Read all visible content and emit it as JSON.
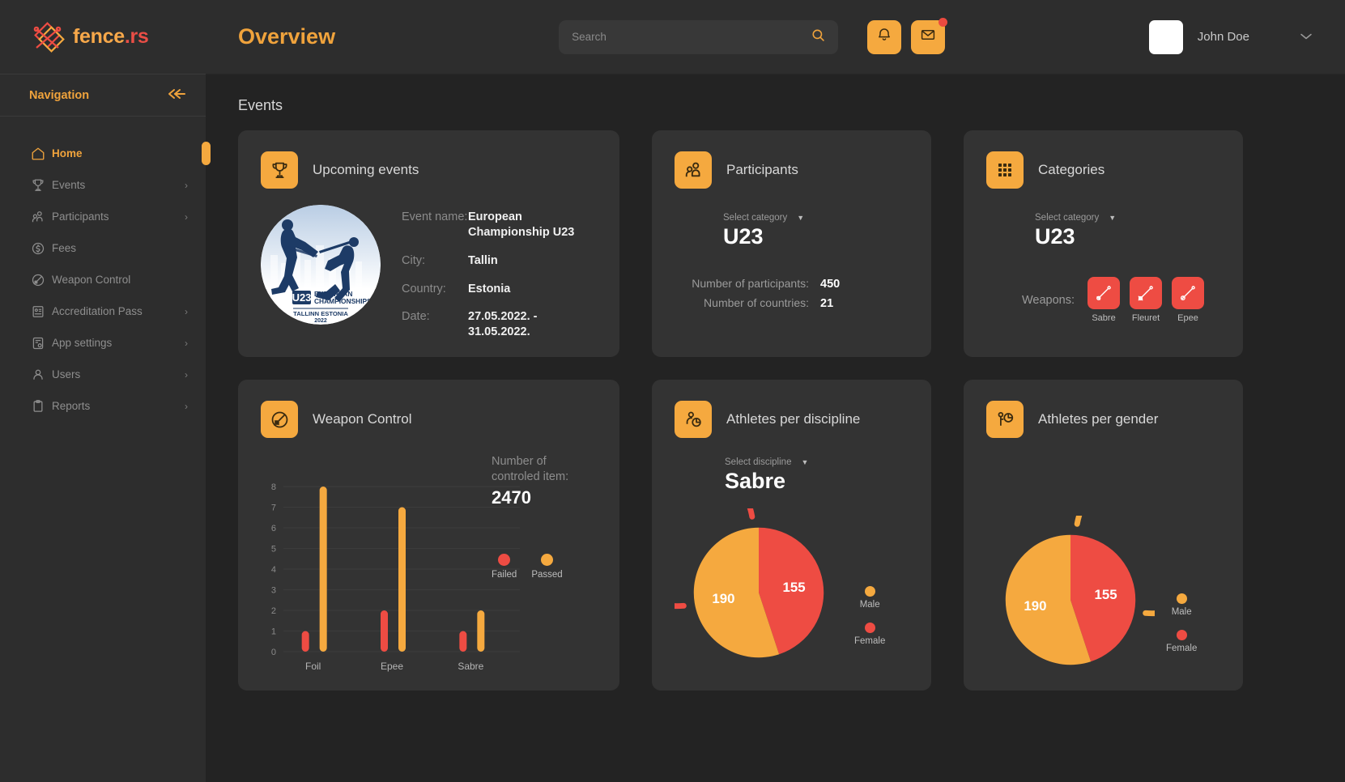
{
  "brand": {
    "name_part1": "fence",
    "name_part2": ".rs",
    "logo_icon": "diamond-fence-logo"
  },
  "sidebar": {
    "nav_header": "Navigation",
    "collapse_icon": "double-chevron-left-icon",
    "items": [
      {
        "label": "Home",
        "icon": "home-icon",
        "active": true,
        "arrow": ""
      },
      {
        "label": "Events",
        "icon": "trophy-icon",
        "active": false,
        "arrow": "›"
      },
      {
        "label": "Participants",
        "icon": "people-icon",
        "active": false,
        "arrow": "›"
      },
      {
        "label": "Fees",
        "icon": "dollar-circle-icon",
        "active": false,
        "arrow": ""
      },
      {
        "label": "Weapon Control",
        "icon": "weapon-circle-icon",
        "active": false,
        "arrow": ""
      },
      {
        "label": "Accreditation Pass",
        "icon": "id-card-icon",
        "active": false,
        "arrow": "›"
      },
      {
        "label": "App settings",
        "icon": "app-settings-icon",
        "active": false,
        "arrow": "›"
      },
      {
        "label": "Users",
        "icon": "user-icon",
        "active": false,
        "arrow": "›"
      },
      {
        "label": "Reports",
        "icon": "clipboard-icon",
        "active": false,
        "arrow": "›"
      }
    ]
  },
  "header": {
    "title": "Overview",
    "search": {
      "value": "",
      "placeholder": "Search",
      "icon": "search-icon"
    },
    "notification_icon": "bell-icon",
    "messages_icon": "envelope-icon",
    "messages_has_badge": true,
    "user_name": "John Doe",
    "user_chevron": "∨"
  },
  "content": {
    "section_title": "Events",
    "cards": {
      "upcoming": {
        "title": "Upcoming events",
        "icon": "trophy-icon",
        "logo_alt": "U23 European Championships Tallinn Estonia 2022",
        "logo_text": {
          "badge": "U23",
          "line1": "EUROPEAN",
          "line2": "CHAMPIONSHIPS",
          "line3": "TALLINN ESTONIA",
          "line4": "2022"
        },
        "rows": [
          {
            "key": "Event name:",
            "value": "European Championship U23"
          },
          {
            "key": "City:",
            "value": "Tallin"
          },
          {
            "key": "Country:",
            "value": "Estonia"
          },
          {
            "key": "Date:",
            "value": "27.05.2022. - 31.05.2022."
          }
        ]
      },
      "participants": {
        "title": "Participants",
        "icon": "people-icon",
        "select_label": "Select category",
        "select_value": "U23",
        "stats": [
          {
            "key": "Number of participants:",
            "value": "450"
          },
          {
            "key": "Number of countries:",
            "value": "21"
          }
        ]
      },
      "categories": {
        "title": "Categories",
        "icon": "grid-icon",
        "select_label": "Select category",
        "select_value": "U23",
        "weapons_label": "Weapons:",
        "weapons": [
          {
            "name": "Sabre",
            "icon": "sabre-icon"
          },
          {
            "name": "Fleuret",
            "icon": "fleuret-icon"
          },
          {
            "name": "Epee",
            "icon": "epee-icon"
          }
        ]
      },
      "weapon_control": {
        "title": "Weapon Control",
        "icon": "weapon-circle-icon",
        "count_label_line1": "Number of",
        "count_label_line2": "controled item:",
        "count_value": "2470"
      },
      "athletes_discipline": {
        "title": "Athletes per discipline",
        "icon": "person-pie-icon",
        "select_label": "Select discipline",
        "select_value": "Sabre"
      },
      "athletes_gender": {
        "title": "Athletes per gender",
        "icon": "person-presenting-pie-icon"
      }
    }
  },
  "colors": {
    "accent_orange": "#f5a93f",
    "accent_red": "#ee4c43",
    "card_bg": "#333333",
    "page_bg": "#232323",
    "sidebar_bg": "#2d2d2d"
  },
  "chart_data": [
    {
      "id": "weapon_control_bars",
      "type": "bar",
      "title": "Weapon Control",
      "categories": [
        "Foil",
        "Epee",
        "Sabre"
      ],
      "series": [
        {
          "name": "Failed",
          "color": "#ee4c43",
          "values": [
            1,
            2,
            1
          ]
        },
        {
          "name": "Passed",
          "color": "#f5a93f",
          "values": [
            8,
            7,
            2
          ]
        }
      ],
      "ylabel": "",
      "xlabel": "",
      "ylim": [
        0,
        8
      ],
      "yticks": [
        0,
        1,
        2,
        3,
        4,
        5,
        6,
        7,
        8
      ],
      "grid": true,
      "legend_position": "right"
    },
    {
      "id": "athletes_per_discipline_pie",
      "type": "pie",
      "title": "Athletes per discipline",
      "subtitle": "Sabre",
      "labels": [
        "Female",
        "Male"
      ],
      "values": [
        155,
        190
      ],
      "colors": [
        "#ee4c43",
        "#f5a93f"
      ],
      "legend": [
        {
          "name": "Male",
          "color": "#f5a93f"
        },
        {
          "name": "Female",
          "color": "#ee4c43"
        }
      ],
      "legend_position": "right",
      "accent_arc_color": "#ee4c43"
    },
    {
      "id": "athletes_per_gender_pie",
      "type": "pie",
      "title": "Athletes per gender",
      "labels": [
        "Female",
        "Male"
      ],
      "values": [
        155,
        190
      ],
      "colors": [
        "#ee4c43",
        "#f5a93f"
      ],
      "legend": [
        {
          "name": "Male",
          "color": "#f5a93f"
        },
        {
          "name": "Female",
          "color": "#ee4c43"
        }
      ],
      "legend_position": "right",
      "accent_arc_color": "#f5a93f"
    }
  ]
}
